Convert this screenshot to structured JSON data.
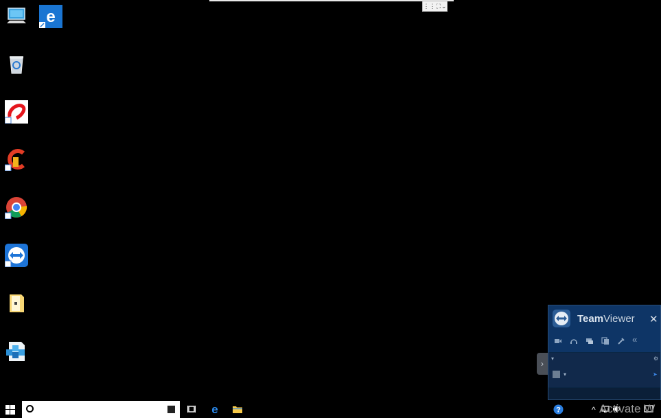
{
  "remote_toolbar": {
    "grip_glyph": "⋮⋮",
    "expand_glyph": "⛶",
    "chevron_glyph": "⌄"
  },
  "desktop_icons": [
    {
      "name": "this-pc-icon"
    },
    {
      "name": "edge-shortcut-icon"
    },
    {
      "name": "recycle-bin-icon"
    },
    {
      "name": "airtel-shortcut-icon"
    },
    {
      "name": "ccleaner-shortcut-icon"
    },
    {
      "name": "chrome-shortcut-icon"
    },
    {
      "name": "teamviewer-shortcut-icon"
    },
    {
      "name": "folder-shortcut-icon"
    },
    {
      "name": "package-app-icon"
    }
  ],
  "taskbar": {
    "search_value": "",
    "tray_chevron": "^",
    "watermark": "Activate W"
  },
  "teamviewer_panel": {
    "title_bold": "Team",
    "title_light": "Viewer",
    "close_glyph": "✕",
    "tab_glyph": "›",
    "collapse_glyph": "«",
    "dropdown_glyph": "▾",
    "colors": {
      "header": "#0e3566",
      "body": "#11294b",
      "accent": "#2c5d96"
    }
  }
}
